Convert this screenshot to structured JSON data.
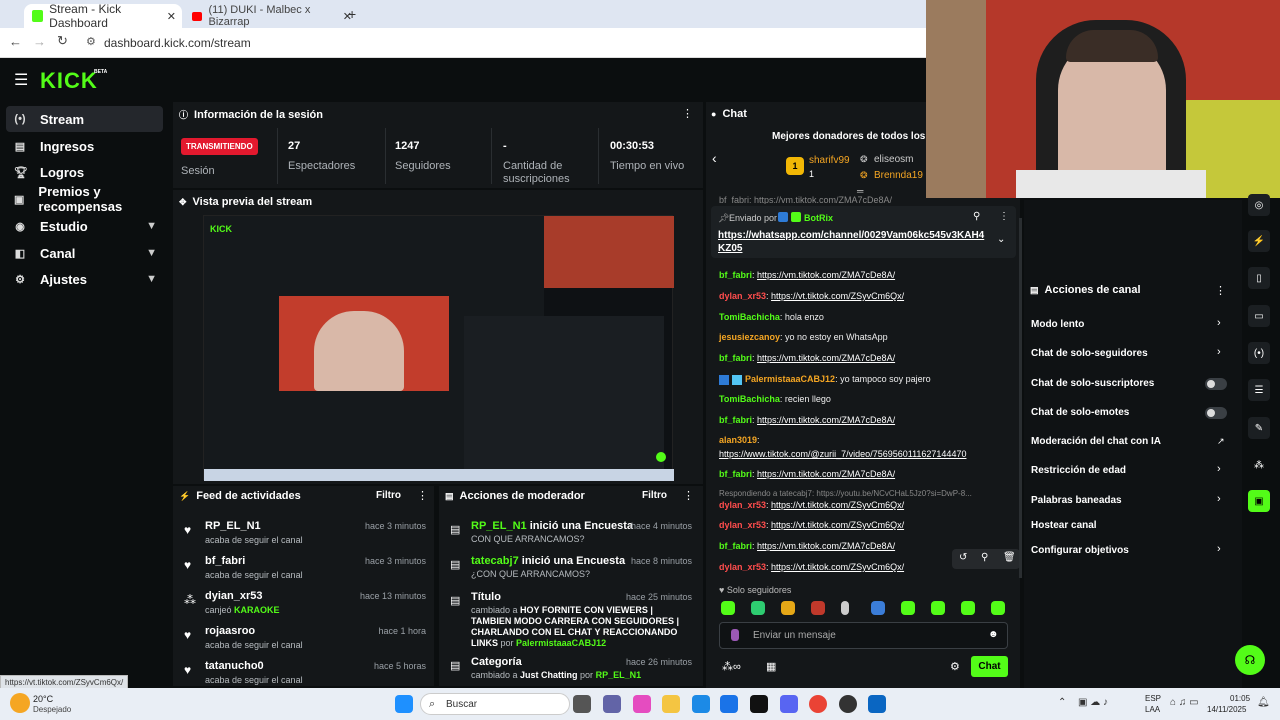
{
  "browser": {
    "tabs": [
      {
        "label": "Stream - Kick Dashboard",
        "active": true
      },
      {
        "label": "(11) DUKI - Malbec x Bizarrap",
        "active": false
      }
    ],
    "url": "dashboard.kick.com/stream",
    "status_url": "https://vt.tiktok.com/ZSyvCm6Qx/"
  },
  "app": {
    "logo": "KICK",
    "logo_badge": "BETA"
  },
  "sidebar": {
    "items": [
      {
        "label": "Stream",
        "icon": "radio-icon",
        "active": true
      },
      {
        "label": "Ingresos",
        "icon": "ledger-icon"
      },
      {
        "label": "Logros",
        "icon": "trophy-icon"
      },
      {
        "label": "Premios y recompensas",
        "icon": "gift-icon"
      },
      {
        "label": "Estudio",
        "icon": "studio-icon",
        "expandable": true
      },
      {
        "label": "Canal",
        "icon": "channel-icon",
        "expandable": true
      },
      {
        "label": "Ajustes",
        "icon": "gear-icon",
        "expandable": true
      }
    ]
  },
  "session": {
    "title": "Información de la sesión",
    "badge": "TRANSMITIENDO",
    "badge_label": "Sesión",
    "stats": [
      {
        "value": "27",
        "label": "Espectadores"
      },
      {
        "value": "1247",
        "label": "Seguidores"
      },
      {
        "value": "-",
        "label": "Cantidad de suscripciones"
      },
      {
        "value": "00:30:53",
        "label": "Tiempo en vivo"
      }
    ]
  },
  "preview": {
    "title": "Vista previa del stream"
  },
  "activity": {
    "title": "Feed de actividades",
    "filter": "Filtro",
    "items": [
      {
        "name": "RP_EL_N1",
        "sub": "acaba de seguir el canal",
        "time": "hace 3 minutos",
        "icon": "heart-icon"
      },
      {
        "name": "bf_fabri",
        "sub": "acaba de seguir el canal",
        "time": "hace 3 minutos",
        "icon": "heart-icon"
      },
      {
        "name": "dyian_xr53",
        "sub": "canjeó",
        "sub_highlight": "KARAOKE",
        "time": "hace 13 minutos",
        "icon": "reward-icon"
      },
      {
        "name": "rojaasroo",
        "sub": "acaba de seguir el canal",
        "time": "hace 1 hora",
        "icon": "heart-icon"
      },
      {
        "name": "tatanucho0",
        "sub": "acaba de seguir el canal",
        "time": "hace 5 horas",
        "icon": "heart-icon"
      }
    ]
  },
  "modactions": {
    "title": "Acciones de moderador",
    "filter": "Filtro",
    "items": [
      {
        "user": "RP_EL_N1",
        "action": " inició una Encuesta",
        "detail": "CON QUE ARRANCAMOS?",
        "time": "hace 4 minutos"
      },
      {
        "user": "tatecabj7",
        "action": " inició una Encuesta",
        "detail": "¿CON QUE ARRANCAMOS?",
        "time": "hace 8 minutos"
      },
      {
        "user": "Título",
        "action": "",
        "detail_prefix": "cambiado a ",
        "detail": "HOY FORNITE CON VIEWERS | TAMBIEN MODO CARRERA CON SEGUIDORES | CHARLANDO CON EL CHAT Y REACCIONANDO LINKS",
        "by": "por",
        "by_user": "PalermistaaaCABJ12",
        "time": "hace 25 minutos"
      },
      {
        "user": "Categoría",
        "action": "",
        "detail_prefix": "cambiado a ",
        "detail": "Just Chatting",
        "by": "por",
        "by_user": "RP_EL_N1",
        "time": "hace 26 minutos"
      }
    ]
  },
  "chat": {
    "title": "Chat",
    "donors_title": "Mejores donadores de todos los ti",
    "donors": [
      {
        "name": "sharifv99",
        "count": "1"
      },
      {
        "name": "eliseosm"
      },
      {
        "name": "Brennda19"
      }
    ],
    "pinned": {
      "label": "Enviado por",
      "user": "BotRix",
      "link": "https://whatsapp.com/channel/0029Vam06kc545v3KAH4KZ05",
      "link_line1": "https://whatsapp.com/channel/0029Vam06kc545v3KAH4",
      "link_line2": "KZ05"
    },
    "top_cut": "bf_fabri: https://vm.tiktok.com/ZMA7cDe8A/",
    "messages": [
      {
        "user": "bf_fabri",
        "color": "#53fc18",
        "text": "https://vm.tiktok.com/ZMA7cDe8A/",
        "link": true
      },
      {
        "user": "dylan_xr53",
        "color": "#ff4d4d",
        "text": "https://vt.tiktok.com/ZSyvCm6Qx/",
        "link": true
      },
      {
        "user": "TomiBachicha",
        "color": "#53fc18",
        "text": "hola enzo"
      },
      {
        "user": "jesusiezcanoy",
        "color": "#f5a623",
        "text": "yo no estoy en WhatsApp"
      },
      {
        "user": "bf_fabri",
        "color": "#53fc18",
        "text": "https://vm.tiktok.com/ZMA7cDe8A/",
        "link": true
      },
      {
        "user": "PalermistaaaCABJ12",
        "color": "#f5a623",
        "text": "yo tampoco soy pajero"
      },
      {
        "user": "TomiBachicha",
        "color": "#53fc18",
        "text": "recien llego"
      },
      {
        "user": "bf_fabri",
        "color": "#53fc18",
        "text": "https://vm.tiktok.com/ZMA7cDe8A/",
        "link": true
      },
      {
        "user": "alan3019",
        "color": "#f5a623",
        "text": ""
      },
      {
        "user": "",
        "color": "#fff",
        "text": "https://www.tiktok.com/@zurii_7/video/7569560111627144470",
        "link": true
      },
      {
        "user": "bf_fabri",
        "color": "#53fc18",
        "text": "https://vm.tiktok.com/ZMA7cDe8A/",
        "link": true
      }
    ],
    "reply": "Respondiendo a tatecabj7: https://youtu.be/NCvCHaL5Jz0?si=DwP-8...",
    "messages2": [
      {
        "user": "dylan_xr53",
        "color": "#ff4d4d",
        "text": "https://vt.tiktok.com/ZSyvCm6Qx/"
      },
      {
        "user": "dylan_xr53",
        "color": "#ff4d4d",
        "text": "https://vt.tiktok.com/ZSyvCm6Qx/"
      },
      {
        "user": "bf_fabri",
        "color": "#53fc18",
        "text": "https://vm.tiktok.com/ZMA7cDe8A/"
      },
      {
        "user": "dylan_xr53",
        "color": "#ff4d4d",
        "text": "https://vt.tiktok.com/ZSyvCm6Qx/"
      }
    ],
    "mode": "Solo seguidores",
    "placeholder": "Enviar un mensaje",
    "send": "Chat"
  },
  "channel_actions": {
    "title": "Acciones de canal",
    "items": [
      {
        "label": "Modo lento",
        "control": "arrow"
      },
      {
        "label": "Chat de solo-seguidores",
        "control": "arrow"
      },
      {
        "label": "Chat de solo-suscriptores",
        "control": "toggle"
      },
      {
        "label": "Chat de solo-emotes",
        "control": "toggle"
      },
      {
        "label": "Moderación del chat con IA",
        "control": "external"
      },
      {
        "label": "Restricción de edad",
        "control": "arrow"
      },
      {
        "label": "Palabras baneadas",
        "control": "arrow"
      },
      {
        "label": "Hostear canal",
        "control": "none"
      },
      {
        "label": "Configurar objetivos",
        "control": "arrow"
      }
    ]
  },
  "taskbar": {
    "weather": "20°C",
    "weather_sub": "Despejado",
    "search": "Buscar",
    "lang": "ESP",
    "lang_sub": "LAA",
    "time": "01:05",
    "date": "14/11/2025"
  }
}
